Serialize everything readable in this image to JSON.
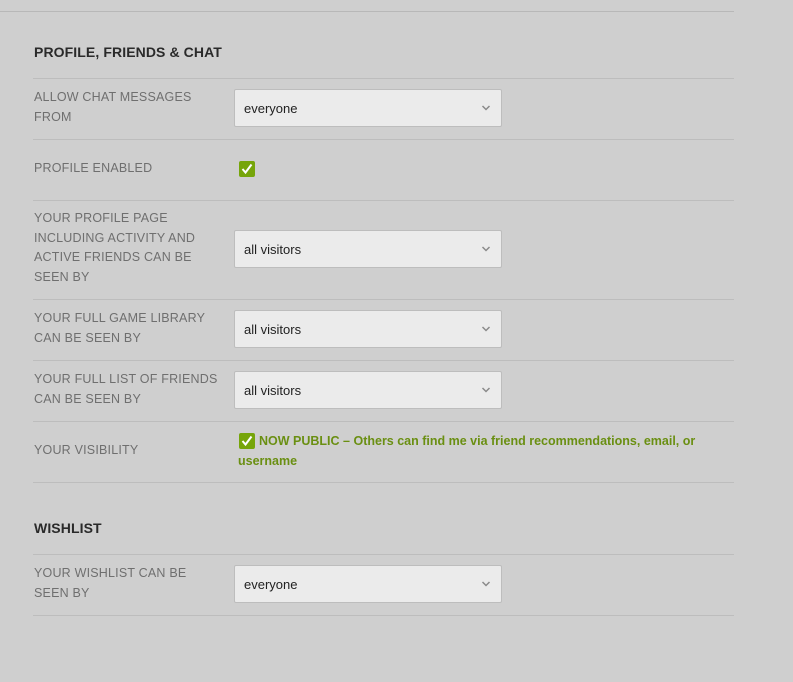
{
  "sections": {
    "profile": {
      "title": "PROFILE, FRIENDS & CHAT",
      "chat_messages": {
        "label": "ALLOW CHAT MESSAGES FROM",
        "value": "everyone"
      },
      "profile_enabled": {
        "label": "PROFILE ENABLED",
        "checked": true
      },
      "profile_page": {
        "label": "YOUR PROFILE PAGE INCLUDING ACTIVITY AND ACTIVE FRIENDS CAN BE SEEN BY",
        "value": "all visitors"
      },
      "game_library": {
        "label": "YOUR FULL GAME LIBRARY CAN BE SEEN BY",
        "value": "all visitors"
      },
      "friends_list": {
        "label": "YOUR FULL LIST OF FRIENDS CAN BE SEEN BY",
        "value": "all visitors"
      },
      "visibility": {
        "label": "YOUR VISIBILITY",
        "checked": true,
        "status": "NOW PUBLIC",
        "description": "– Others can find me via friend recommendations, email, or username"
      }
    },
    "wishlist": {
      "title": "WISHLIST",
      "wishlist_visibility": {
        "label": "YOUR WISHLIST CAN BE SEEN BY",
        "value": "everyone"
      }
    }
  },
  "colors": {
    "background": "#cfcfcf",
    "accent_green": "#76a50a",
    "public_text": "#6a8f12",
    "label_gray": "#6f6f6f"
  },
  "icons": {
    "select_arrow": "chevron-down-icon",
    "checkbox_mark": "checkmark-icon"
  }
}
